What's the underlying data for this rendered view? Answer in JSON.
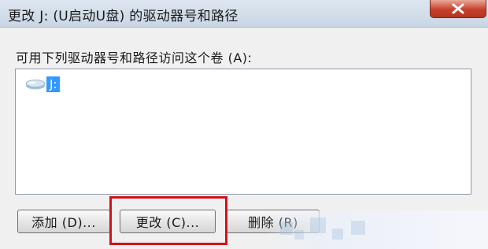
{
  "window": {
    "title": "更改 J: (U启动U盘) 的驱动器号和路径",
    "close_label": "✕"
  },
  "dialog": {
    "prompt": "可用下列驱动器号和路径访问这个卷 (A):",
    "volumes": [
      {
        "label": "J:",
        "selected": true,
        "icon": "drive-icon"
      }
    ]
  },
  "buttons": {
    "add": "添加 (D)...",
    "change": "更改 (C)...",
    "remove": "删除 (R)"
  },
  "colors": {
    "selection": "#3399ff",
    "highlight_box": "#d0131b",
    "close_button": "#c7402c"
  }
}
